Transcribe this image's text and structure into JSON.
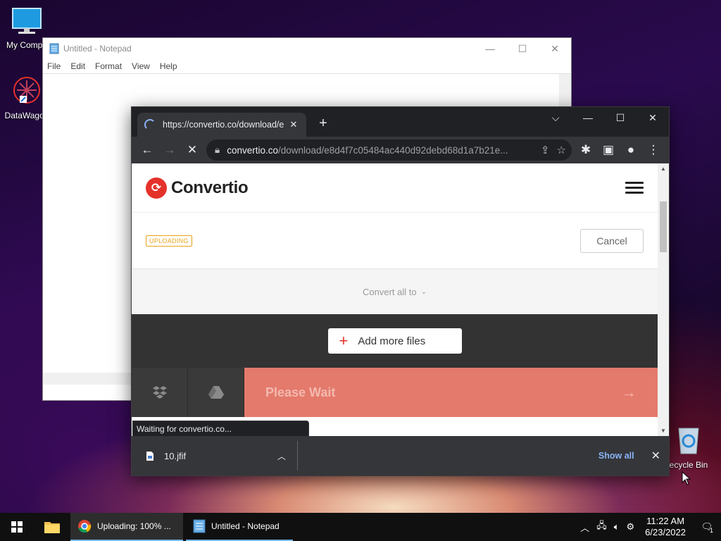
{
  "desktop": {
    "icons": [
      {
        "label": "My Compu"
      },
      {
        "label": "DataWagon"
      },
      {
        "label": "ecycle Bin"
      }
    ]
  },
  "notepad": {
    "title": "Untitled - Notepad",
    "menu": [
      "File",
      "Edit",
      "Format",
      "View",
      "Help"
    ]
  },
  "chrome": {
    "tab_title": "https://convertio.co/download/e",
    "url_host": "convertio.co",
    "url_path": "/download/e8d4f7c05484ac440d92debd68d1a7b21e...",
    "status_text": "Waiting for convertio.co...",
    "download": {
      "filename": "10.jfif",
      "show_all": "Show all"
    }
  },
  "page": {
    "logo_text": "Convertio",
    "badge": "UPLOADING",
    "cancel_label": "Cancel",
    "convert_all_label": "Convert all to",
    "add_more_label": "Add more files",
    "please_wait_label": "Please Wait",
    "colors": {
      "brand": "#e4322b",
      "badge": "#e8a317",
      "action": "#e47a6c"
    }
  },
  "taskbar": {
    "apps": [
      {
        "label": "Uploading: 100% ..."
      },
      {
        "label": "Untitled - Notepad"
      }
    ],
    "time": "11:22 AM",
    "date": "6/23/2022",
    "notification_count": "1"
  }
}
